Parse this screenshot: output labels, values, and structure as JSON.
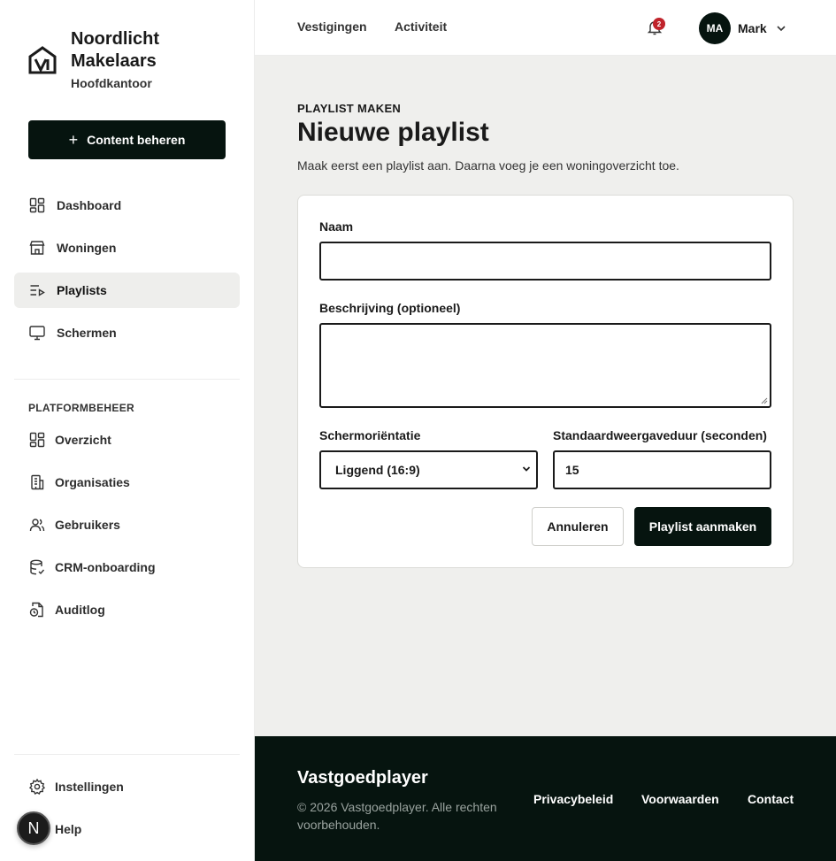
{
  "brand": {
    "name": "Noordlicht Makelaars",
    "subtitle": "Hoofdkantoor"
  },
  "sidebar": {
    "cta_label": "Content beheren",
    "items": [
      {
        "label": "Dashboard",
        "icon": "dashboard-icon"
      },
      {
        "label": "Woningen",
        "icon": "store-icon"
      },
      {
        "label": "Playlists",
        "icon": "playlist-icon",
        "active": true
      },
      {
        "label": "Schermen",
        "icon": "monitor-icon"
      }
    ],
    "section_label": "PLATFORMBEHEER",
    "admin_items": [
      {
        "label": "Overzicht",
        "icon": "dashboard-icon"
      },
      {
        "label": "Organisaties",
        "icon": "building-icon"
      },
      {
        "label": "Gebruikers",
        "icon": "users-icon"
      },
      {
        "label": "CRM-onboarding",
        "icon": "database-icon"
      },
      {
        "label": "Auditlog",
        "icon": "file-clock-icon"
      }
    ],
    "bottom_items": [
      {
        "label": "Instellingen",
        "icon": "gear-icon"
      },
      {
        "label": "Help",
        "icon": "help-icon"
      }
    ],
    "help_avatar_letter": "N"
  },
  "header": {
    "nav": [
      "Vestigingen",
      "Activiteit"
    ],
    "notification_count": "2",
    "user_initials": "MA",
    "user_name": "Mark"
  },
  "main": {
    "eyebrow": "PLAYLIST MAKEN",
    "title": "Nieuwe playlist",
    "description": "Maak eerst een playlist aan. Daarna voeg je een woningoverzicht toe.",
    "form": {
      "name_label": "Naam",
      "name_value": "",
      "description_label": "Beschrijving (optioneel)",
      "description_value": "",
      "orientation_label": "Schermoriëntatie",
      "orientation_value": "Liggend (16:9)",
      "duration_label": "Standaardweergaveduur (seconden)",
      "duration_value": "15",
      "cancel_label": "Annuleren",
      "submit_label": "Playlist aanmaken"
    }
  },
  "footer": {
    "brand": "Vastgoedplayer",
    "copyright": "© 2026 Vastgoedplayer. Alle rechten voorbehouden.",
    "links": [
      "Privacybeleid",
      "Voorwaarden",
      "Contact"
    ]
  },
  "colors": {
    "primary": "#06140f",
    "main_bg": "#efefed",
    "active_nav_bg": "#eeeeec",
    "badge": "#c0232b"
  }
}
